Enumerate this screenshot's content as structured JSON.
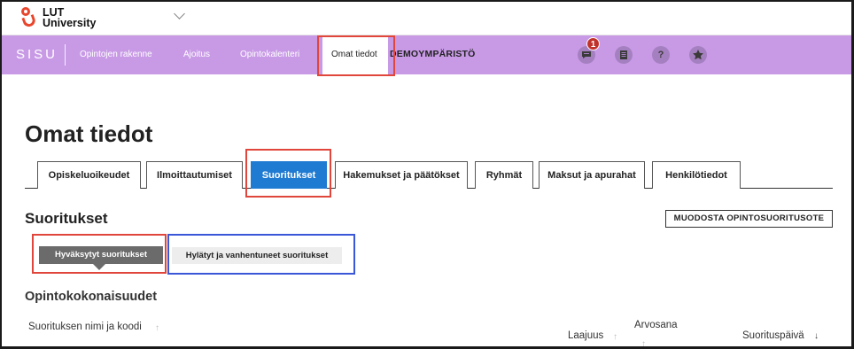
{
  "brand": {
    "logo_line1": "LUT",
    "logo_line2": "University",
    "app_name": "SISU"
  },
  "nav": {
    "items": [
      "Opintojen rakenne",
      "Ajoitus",
      "Opintokalenteri",
      "Omat tiedot"
    ],
    "active": "Omat tiedot",
    "environment_label": "DEMOYMPÄRISTÖ",
    "notification_count": "1",
    "icons": [
      "messages-icon",
      "notes-icon",
      "help-icon",
      "favorites-icon"
    ]
  },
  "page": {
    "title": "Omat tiedot",
    "tabs": [
      "Opiskeluoikeudet",
      "Ilmoittautumiset",
      "Suoritukset",
      "Hakemukset ja päätökset",
      "Ryhmät",
      "Maksut ja apurahat",
      "Henkilötiedot"
    ],
    "active_tab": "Suoritukset"
  },
  "section": {
    "title": "Suoritukset",
    "report_button": "MUODOSTA OPINTOSUORITUSOTE",
    "toggle_accepted": "Hyväksytyt suoritukset",
    "toggle_rejected": "Hylätyt ja vanhentuneet suoritukset"
  },
  "table": {
    "title": "Opintokokonaisuudet",
    "columns": [
      "Suorituksen nimi ja koodi",
      "Laajuus",
      "Arvosana",
      "Suorituspäivä"
    ],
    "sort_up": "↑",
    "sort_down": "↓"
  },
  "colors": {
    "nav_bg": "#c89ae6",
    "active_tab": "#1f7ad1",
    "highlight_red": "#e0463b",
    "highlight_blue": "#3a57d8",
    "badge": "#c0322a"
  }
}
